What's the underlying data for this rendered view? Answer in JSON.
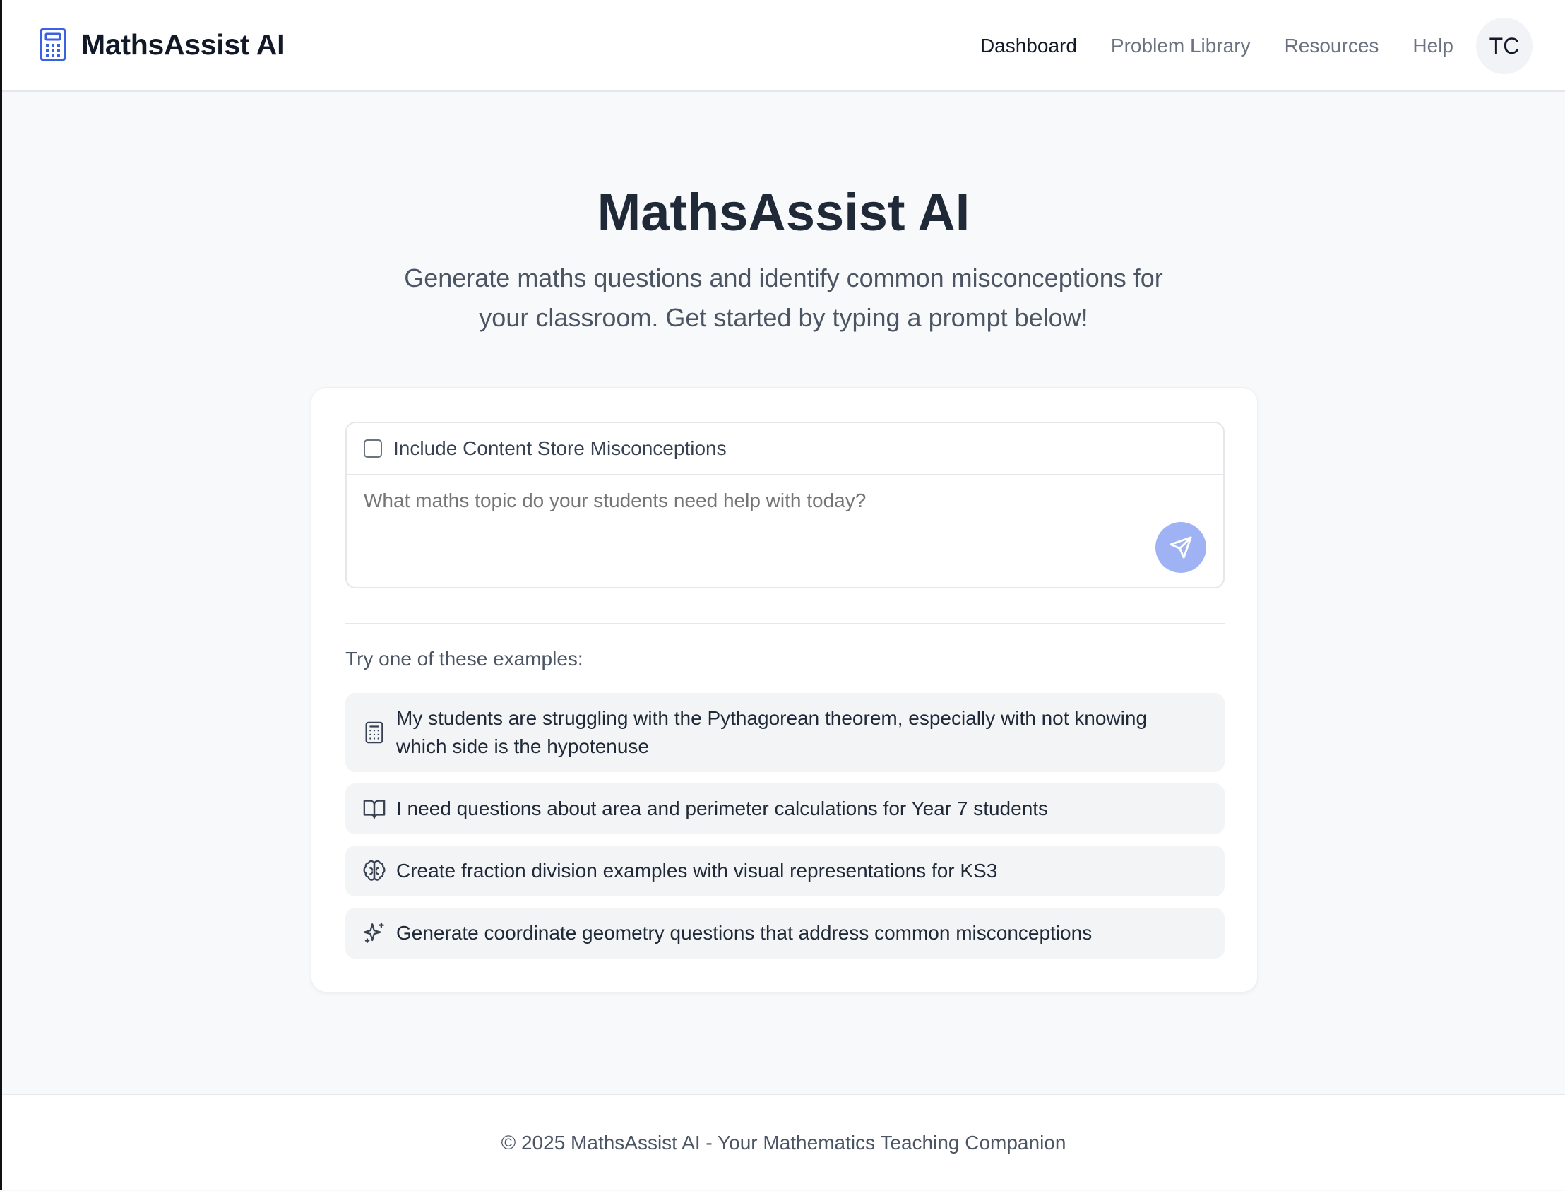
{
  "header": {
    "app_name": "MathsAssist AI",
    "nav": [
      {
        "label": "Dashboard",
        "active": true
      },
      {
        "label": "Problem Library",
        "active": false
      },
      {
        "label": "Resources",
        "active": false
      },
      {
        "label": "Help",
        "active": false
      }
    ],
    "avatar_initials": "TC"
  },
  "hero": {
    "title": "MathsAssist AI",
    "subtitle": "Generate maths questions and identify common misconceptions for your classroom. Get started by typing a prompt below!"
  },
  "prompt": {
    "checkbox_label": "Include Content Store Misconceptions",
    "checkbox_checked": false,
    "placeholder": "What maths topic do your students need help with today?",
    "value": ""
  },
  "examples": {
    "heading": "Try one of these examples:",
    "items": [
      {
        "icon": "calculator-icon",
        "text": "My students are struggling with the Pythagorean theorem, especially with not knowing which side is the hypotenuse"
      },
      {
        "icon": "book-open-icon",
        "text": "I need questions about area and perimeter calculations for Year 7 students"
      },
      {
        "icon": "brain-icon",
        "text": "Create fraction division examples with visual representations for KS3"
      },
      {
        "icon": "sparkles-icon",
        "text": "Generate coordinate geometry questions that address common misconceptions"
      }
    ]
  },
  "footer": {
    "text": "© 2025 MathsAssist AI - Your Mathematics Teaching Companion"
  },
  "colors": {
    "accent": "#3b63e0",
    "send_button": "#9fb3f4",
    "page_background": "#f8f9fb",
    "example_background": "#f3f4f6"
  }
}
